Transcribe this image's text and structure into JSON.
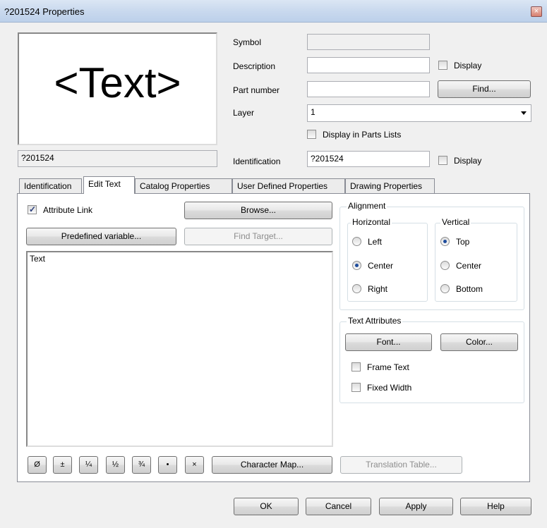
{
  "window": {
    "title": "?201524  Properties"
  },
  "preview": {
    "text": "<Text>",
    "caption": "?201524"
  },
  "fields": {
    "symbol_label": "Symbol",
    "symbol_value": "",
    "description_label": "Description",
    "description_value": "",
    "description_display_label": "Display",
    "part_number_label": "Part number",
    "part_number_value": "",
    "find_label": "Find...",
    "layer_label": "Layer",
    "layer_value": "1",
    "display_parts_lists_label": "Display in Parts Lists",
    "identification_label": "Identification",
    "identification_value": "?201524",
    "identification_display_label": "Display"
  },
  "tabs": [
    {
      "label": "Identification"
    },
    {
      "label": "Edit Text"
    },
    {
      "label": "Catalog Properties"
    },
    {
      "label": "User Defined Properties"
    },
    {
      "label": "Drawing Properties"
    }
  ],
  "edit_text": {
    "attribute_link_label": "Attribute Link",
    "attribute_link_checked": true,
    "browse_label": "Browse...",
    "predefined_variable_label": "Predefined variable...",
    "find_target_label": "Find Target...",
    "text_value": "Text",
    "special_chars": [
      "Ø",
      "±",
      "¼",
      "½",
      "¾",
      "•",
      "×"
    ],
    "character_map_label": "Character Map...",
    "translation_table_label": "Translation Table..."
  },
  "alignment": {
    "title": "Alignment",
    "horizontal_title": "Horizontal",
    "horizontal_options": [
      "Left",
      "Center",
      "Right"
    ],
    "horizontal_selected": "Center",
    "vertical_title": "Vertical",
    "vertical_options": [
      "Top",
      "Center",
      "Bottom"
    ],
    "vertical_selected": "Top"
  },
  "text_attributes": {
    "title": "Text Attributes",
    "font_label": "Font...",
    "color_label": "Color...",
    "frame_text_label": "Frame Text",
    "fixed_width_label": "Fixed Width"
  },
  "footer": {
    "ok": "OK",
    "cancel": "Cancel",
    "apply": "Apply",
    "help": "Help"
  }
}
